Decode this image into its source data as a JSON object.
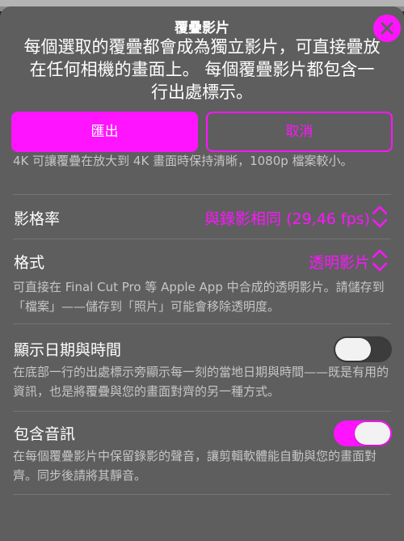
{
  "header": {
    "title": "覆疊影片",
    "body": "每個選取的覆疊都會成為獨立影片，可直接疊放在任何相機的畫面上。 每個覆疊影片都包含一行出處標示。",
    "export_label": "匯出",
    "cancel_label": "取消",
    "close_icon": "close-icon"
  },
  "cut_description": "4K 可讓覆疊在放大到 4K 畫面時保持清晰，1080p 檔案較小。",
  "settings": {
    "frame_rate": {
      "label": "影格率",
      "value": "與錄影相同 (29,46 fps)"
    },
    "format": {
      "label": "格式",
      "value": "透明影片",
      "description": "可直接在 Final Cut Pro 等 Apple App 中合成的透明影片。請儲存到「檔案」——儲存到「照片」可能會移除透明度。"
    },
    "show_datetime": {
      "label": "顯示日期與時間",
      "on": false,
      "description": "在底部一行的出處標示旁顯示每一刻的當地日期與時間——既是有用的資訊，也是將覆疊與您的畫面對齊的另一種方式。"
    },
    "include_audio": {
      "label": "包含音訊",
      "on": true,
      "description": "在每個覆疊影片中保留錄影的聲音，讓剪輯軟體能自動與您的畫面對齊。同步後請將其靜音。"
    }
  },
  "colors": {
    "accent": "#ff14ff",
    "sheet": "#5e5e5e",
    "secondary_text": "#c6c6c6"
  }
}
